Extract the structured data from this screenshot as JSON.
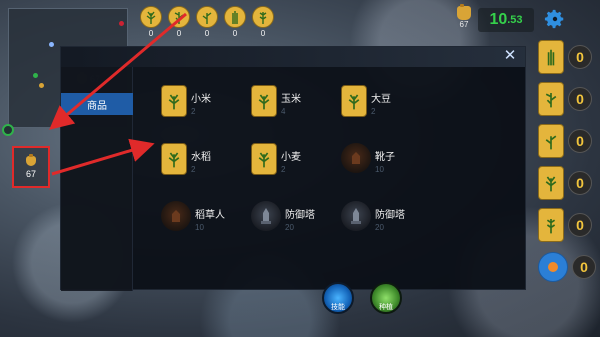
{
  "minimap": {
    "money": "67"
  },
  "wallet": {
    "money": "67"
  },
  "seeds": [
    {
      "icon": "corn-sprout-icon",
      "count": "0"
    },
    {
      "icon": "millet-sprout-icon",
      "count": "0"
    },
    {
      "icon": "bean-sprout-icon",
      "count": "0"
    },
    {
      "icon": "rice-sprout-icon",
      "count": "0"
    },
    {
      "icon": "wheat-sprout-icon",
      "count": "0"
    }
  ],
  "top": {
    "money": "67",
    "timer_main": "10",
    "timer_fraction": ".53"
  },
  "right_items": [
    {
      "count": "0"
    },
    {
      "count": "0"
    },
    {
      "count": "0"
    },
    {
      "count": "0"
    },
    {
      "count": "0"
    },
    {
      "count": "0"
    }
  ],
  "shop": {
    "tab_label": "商品",
    "items": [
      {
        "name": "小米",
        "price": "2",
        "kind": "seedpack"
      },
      {
        "name": "玉米",
        "price": "4",
        "kind": "seedpack"
      },
      {
        "name": "大豆",
        "price": "2",
        "kind": "seedpack"
      },
      {
        "name": "水稻",
        "price": "2",
        "kind": "seedpack"
      },
      {
        "name": "小麦",
        "price": "2",
        "kind": "seedpack"
      },
      {
        "name": "靴子",
        "price": "10",
        "kind": "dark"
      },
      {
        "name": "稻草人",
        "price": "10",
        "kind": "dark"
      },
      {
        "name": "防御塔",
        "price": "20",
        "kind": "tower"
      },
      {
        "name": "防御塔",
        "price": "20",
        "kind": "tower"
      }
    ]
  },
  "bottom": {
    "blue_label": "技能",
    "green_label": "种植"
  },
  "colors": {
    "accent_blue": "#1f5ca6",
    "timer_green": "#35d04b",
    "highlight_red": "#e02a2a",
    "gold": "#e4b53c"
  }
}
